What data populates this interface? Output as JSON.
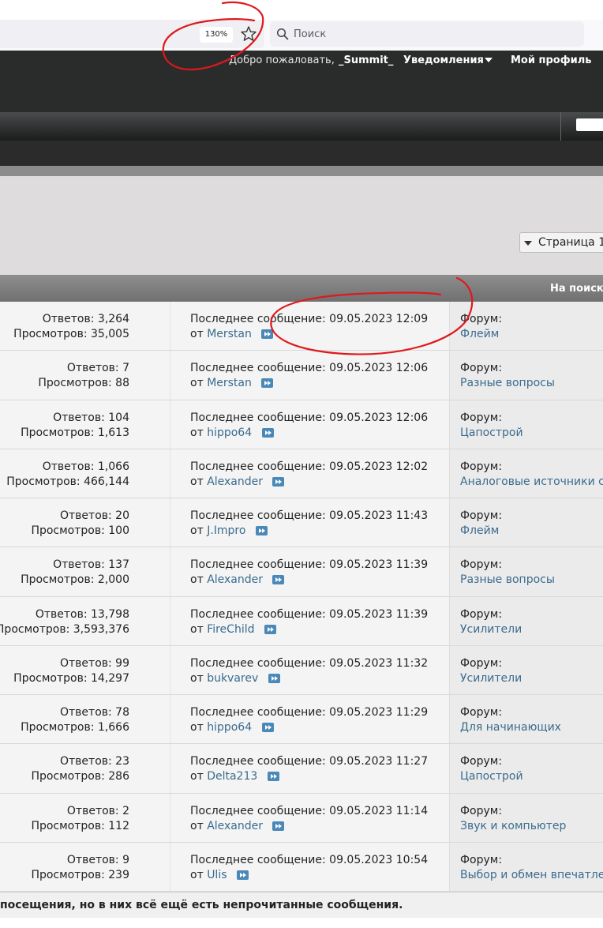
{
  "browser": {
    "zoom_level": "130%",
    "search_placeholder": "Поиск",
    "icons": [
      "star-icon",
      "search-icon"
    ]
  },
  "header": {
    "welcome_text": "Добро пожаловать,",
    "username": "_Summit_",
    "notifications_label": "Уведомления",
    "profile_label": "Мой профиль"
  },
  "pagination": {
    "page_label": "Страница 1"
  },
  "table": {
    "header_label": "На поиск",
    "rows": [
      {
        "replies": "Ответов: 3,264",
        "views": "Просмотров: 35,005",
        "last_post": "Последнее сообщение: 09.05.2023 12:09",
        "by": "от",
        "author": "Merstan",
        "forum_label": "Форум:",
        "forum": "Флейм"
      },
      {
        "replies": "Ответов: 7",
        "views": "Просмотров: 88",
        "last_post": "Последнее сообщение: 09.05.2023 12:06",
        "by": "от",
        "author": "Merstan",
        "forum_label": "Форум:",
        "forum": "Разные вопросы"
      },
      {
        "replies": "Ответов: 104",
        "views": "Просмотров: 1,613",
        "last_post": "Последнее сообщение: 09.05.2023 12:06",
        "by": "от",
        "author": "hippo64",
        "forum_label": "Форум:",
        "forum": "Цапострой"
      },
      {
        "replies": "Ответов: 1,066",
        "views": "Просмотров: 466,144",
        "last_post": "Последнее сообщение: 09.05.2023 12:02",
        "by": "от",
        "author": "Alexander",
        "forum_label": "Форум:",
        "forum": "Аналоговые источники си"
      },
      {
        "replies": "Ответов: 20",
        "views": "Просмотров: 100",
        "last_post": "Последнее сообщение: 09.05.2023 11:43",
        "by": "от",
        "author": "J.Impro",
        "forum_label": "Форум:",
        "forum": "Флейм"
      },
      {
        "replies": "Ответов: 137",
        "views": "Просмотров: 2,000",
        "last_post": "Последнее сообщение: 09.05.2023 11:39",
        "by": "от",
        "author": "Alexander",
        "forum_label": "Форум:",
        "forum": "Разные вопросы"
      },
      {
        "replies": "Ответов: 13,798",
        "views": "Просмотров: 3,593,376",
        "last_post": "Последнее сообщение: 09.05.2023 11:39",
        "by": "от",
        "author": "FireChild",
        "forum_label": "Форум:",
        "forum": "Усилители"
      },
      {
        "replies": "Ответов: 99",
        "views": "Просмотров: 14,297",
        "last_post": "Последнее сообщение: 09.05.2023 11:32",
        "by": "от",
        "author": "bukvarev",
        "forum_label": "Форум:",
        "forum": "Усилители"
      },
      {
        "replies": "Ответов: 78",
        "views": "Просмотров: 1,666",
        "last_post": "Последнее сообщение: 09.05.2023 11:29",
        "by": "от",
        "author": "hippo64",
        "forum_label": "Форум:",
        "forum": "Для начинающих"
      },
      {
        "replies": "Ответов: 23",
        "views": "Просмотров: 286",
        "last_post": "Последнее сообщение: 09.05.2023 11:27",
        "by": "от",
        "author": "Delta213",
        "forum_label": "Форум:",
        "forum": "Цапострой"
      },
      {
        "replies": "Ответов: 2",
        "views": "Просмотров: 112",
        "last_post": "Последнее сообщение: 09.05.2023 11:14",
        "by": "от",
        "author": "Alexander",
        "forum_label": "Форум:",
        "forum": "Звук и компьютер"
      },
      {
        "replies": "Ответов: 9",
        "views": "Просмотров: 239",
        "last_post": "Последнее сообщение: 09.05.2023 10:54",
        "by": "от",
        "author": "Ulis",
        "forum_label": "Форум:",
        "forum": "Выбор и обмен впечатле"
      }
    ]
  },
  "footer": {
    "legend_text": "посещения, но в них всё ещё есть непрочитанные сообщения."
  },
  "annotation_color": "#e0181c"
}
